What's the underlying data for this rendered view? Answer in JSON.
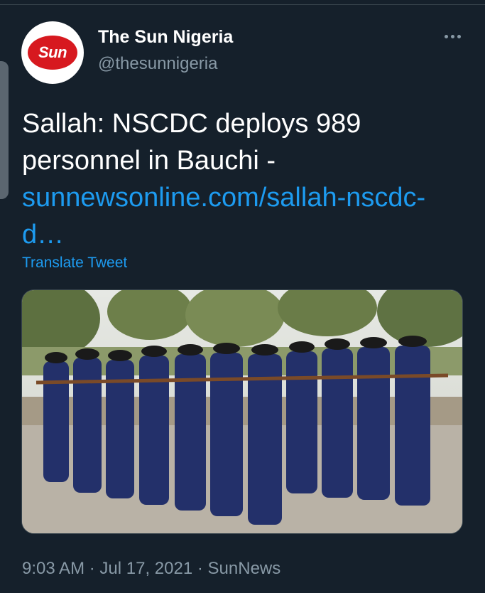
{
  "account": {
    "display_name": "The Sun Nigeria",
    "handle": "@thesunnigeria",
    "avatar_text": "Sun",
    "avatar_color": "#d7191f"
  },
  "tweet": {
    "text_line": "Sallah: NSCDC deploys 989 personnel in Bauchi - ",
    "link_text": "sunnewsonline.com/sallah-nscdc-d…",
    "translate_label": "Translate Tweet",
    "time": "9:03 AM",
    "separator": "·",
    "date": "Jul 17, 2021",
    "source": "SunNews"
  },
  "icons": {
    "more": "more-horizontal-icon"
  },
  "colors": {
    "background": "#15202b",
    "link": "#1d9bf0",
    "muted": "#8899a6",
    "uniform": "#2a3a78"
  }
}
